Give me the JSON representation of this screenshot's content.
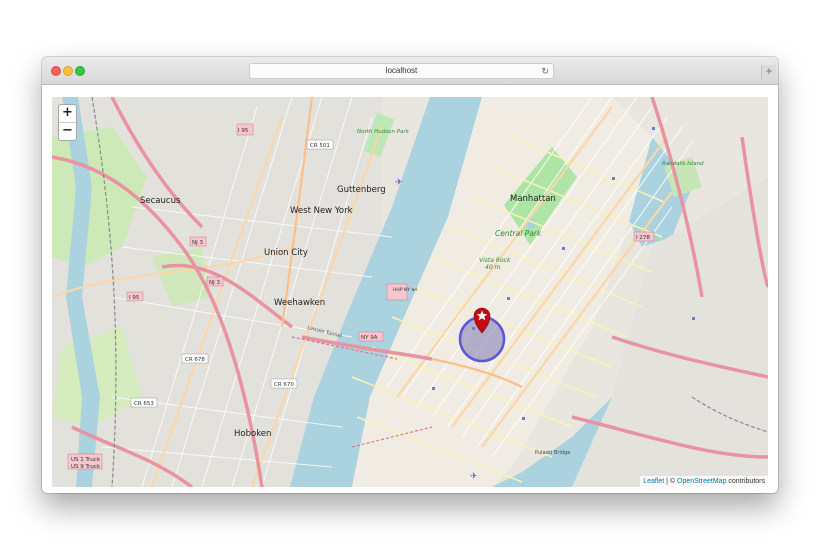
{
  "browser": {
    "url": "localhost",
    "new_tab": "+",
    "reload": "↻"
  },
  "map": {
    "zoom_in": "+",
    "zoom_out": "−",
    "labels": {
      "secaucus": "Secaucus",
      "guttenberg": "Guttenberg",
      "west_new_york": "West New York",
      "union_city": "Union City",
      "weehawken": "Weehawken",
      "hoboken": "Hoboken",
      "manhattan": "Manhattan",
      "central_park": "Central Park",
      "vista_rock": "Vista Rock",
      "vista_rock_elev": "40 m",
      "north_hudson_park": "North Hudson Park",
      "cr501": "CR 501",
      "nj3": "NJ 3",
      "i95": "I 95",
      "nj9a": "NY 9A",
      "hhp": "HHP NY 9A",
      "cr670": "CR 670",
      "cr678": "CR 678",
      "cr653": "CR 653",
      "i278": "I 278",
      "us1": "US 1 Truck",
      "us9": "US 9 Truck",
      "randalls": "Randalls Island",
      "pulaski": "Pulaski Bridge",
      "lincoln": "Lincoln Tunnel"
    },
    "marker": {
      "type": "map-pin-star",
      "color": "#c30b16"
    },
    "circle": {
      "stroke": "#5a57d8",
      "fill": "#7d7ab5"
    },
    "colors": {
      "water": "#aad3df",
      "park": "#c8facc",
      "urban": "#e0dfdf",
      "highway": "#e892a2",
      "primary": "#fcd6a4",
      "secondary": "#f7fabf"
    }
  },
  "attribution": {
    "leaflet": "Leaflet",
    "separator": " | © ",
    "osm": "OpenStreetMap",
    "contributors": " contributors"
  }
}
